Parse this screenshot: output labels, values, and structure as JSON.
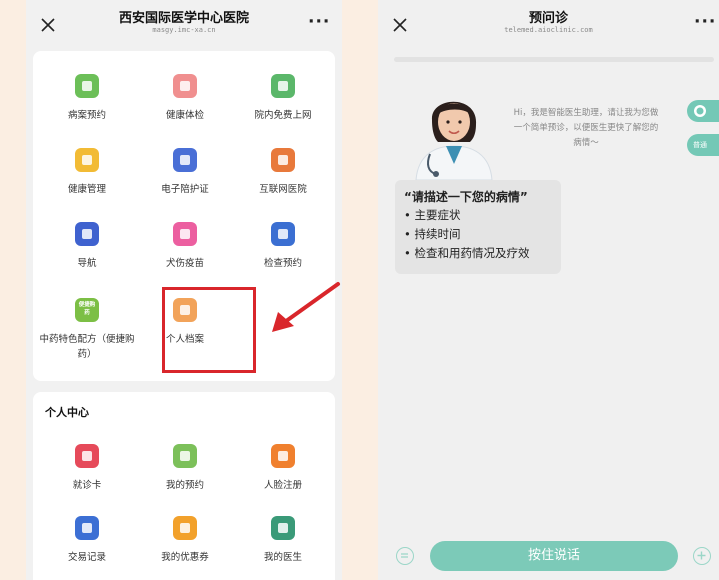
{
  "left": {
    "nav": {
      "title": "西安国际医学中心医院",
      "subtitle": "masgy.imc-xa.cn",
      "more": "···"
    },
    "services": [
      {
        "label": "病案预约",
        "icon": "medical-record-icon",
        "color": "#6cbf58"
      },
      {
        "label": "健康体检",
        "icon": "health-check-icon",
        "color": "#f08f8f"
      },
      {
        "label": "院内免费上网",
        "icon": "wifi-icon",
        "color": "#5bb76a"
      },
      {
        "label": "健康管理",
        "icon": "shield-icon",
        "color": "#f2bb35"
      },
      {
        "label": "电子陪护证",
        "icon": "id-card-icon",
        "color": "#4a6fd6"
      },
      {
        "label": "互联网医院",
        "icon": "hospital-icon",
        "color": "#e8793b"
      },
      {
        "label": "导航",
        "icon": "navigation-icon",
        "color": "#3f62cf"
      },
      {
        "label": "犬伤疫苗",
        "icon": "dog-vaccine-icon",
        "color": "#ec5fa0"
      },
      {
        "label": "检查预约",
        "icon": "calendar-icon",
        "color": "#3b6fd2"
      },
      {
        "label": "中药特色配方（便捷购药）",
        "icon": "herbal-medicine-icon",
        "color": "#7cbf45",
        "badge": "便捷购药"
      },
      {
        "label": "个人档案",
        "icon": "personal-file-icon",
        "color": "#f2a35a"
      }
    ],
    "personal_center": {
      "title": "个人中心",
      "items": [
        {
          "label": "就诊卡",
          "icon": "visit-card-icon",
          "color": "#e64a5a"
        },
        {
          "label": "我的预约",
          "icon": "clock-icon",
          "color": "#7cc05a"
        },
        {
          "label": "人脸注册",
          "icon": "face-icon",
          "color": "#f0802e"
        },
        {
          "label": "交易记录",
          "icon": "transaction-icon",
          "color": "#3c6fd4"
        },
        {
          "label": "我的优惠券",
          "icon": "coupon-icon",
          "color": "#f2a12b"
        },
        {
          "label": "我的医生",
          "icon": "doctor-icon",
          "color": "#3a9a78"
        }
      ]
    }
  },
  "right": {
    "nav": {
      "title": "预问诊",
      "subtitle": "telemed.aioclinic.com",
      "more": "···"
    },
    "greeting": "Hi，我是智能医生助理，请让我为您做一个简单预诊，以便医生更快了解您的病情～",
    "prompt": {
      "question": "“请描述一下您的病情”",
      "items": [
        "• 主要症状",
        "• 持续时间",
        "• 检查和用药情况及疗效"
      ]
    },
    "side_buttons": [
      "",
      "普通"
    ],
    "voice_button": "按住说话",
    "accent": "#7ccab8"
  }
}
